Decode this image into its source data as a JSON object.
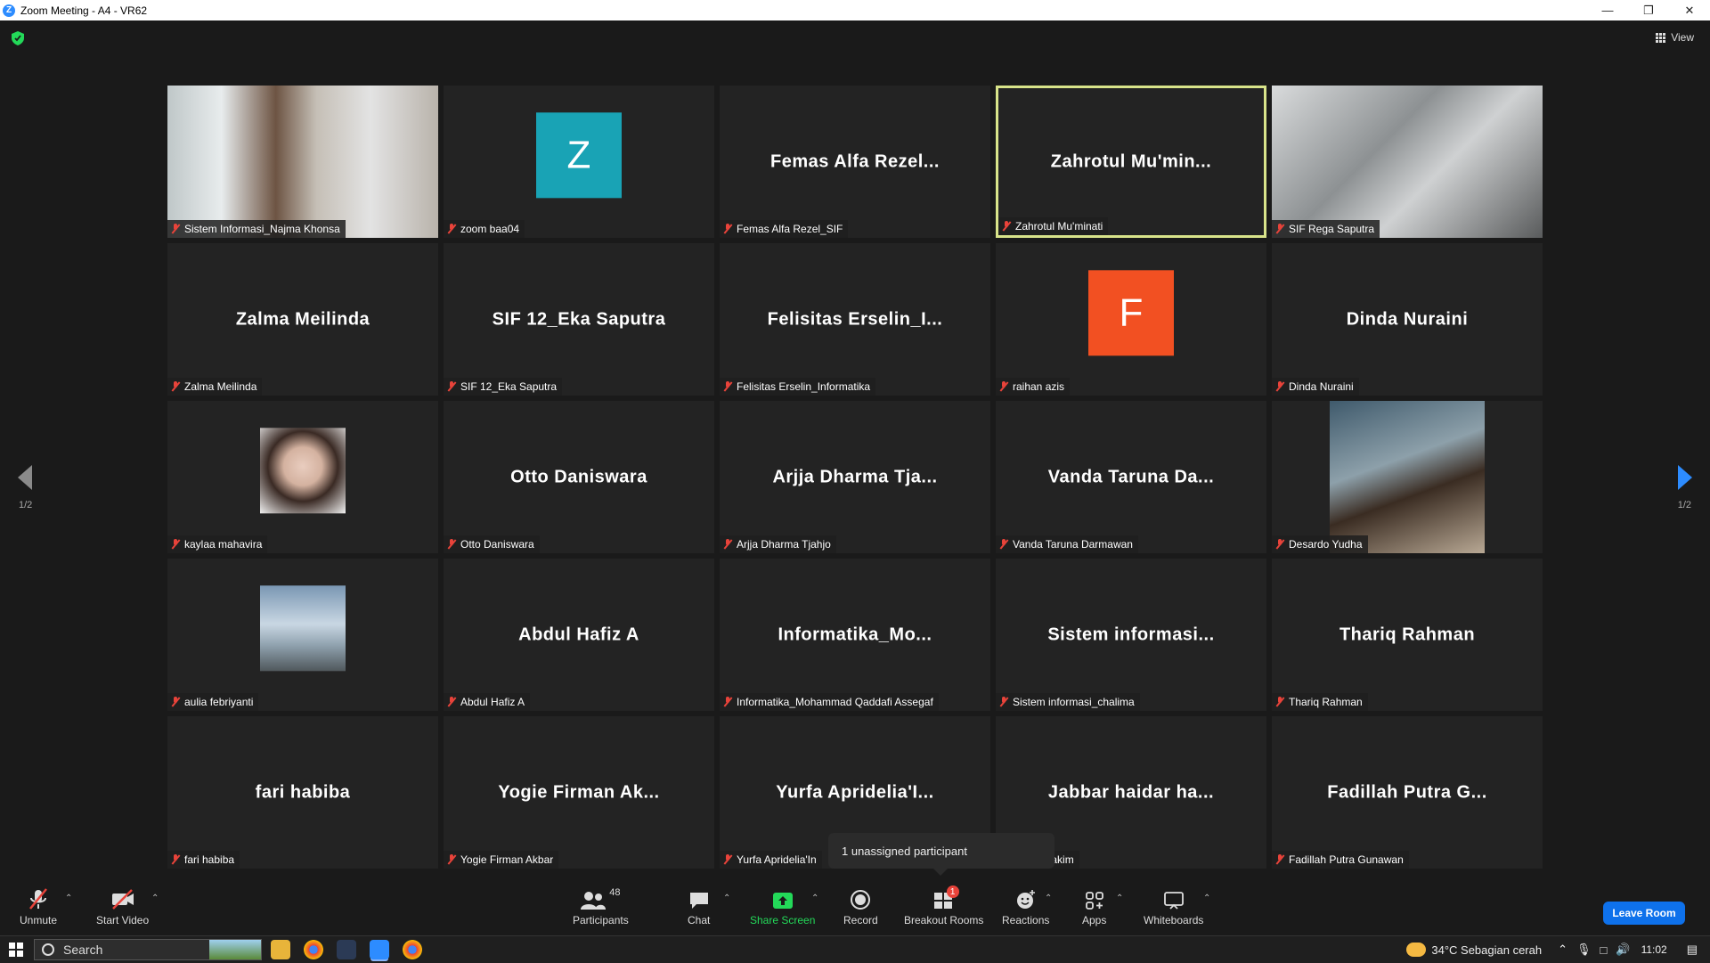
{
  "window": {
    "title": "Zoom Meeting - A4 - VR62"
  },
  "top": {
    "view_label": "View"
  },
  "pager": {
    "left": "1/2",
    "right": "1/2"
  },
  "tiles": [
    {
      "big": "",
      "label": "Sistem Informasi_Najma Khonsa",
      "kind": "photo"
    },
    {
      "big": "",
      "label": "zoom baa04",
      "kind": "letter",
      "letter": "Z",
      "color": "#19a3b5"
    },
    {
      "big": "Femas Alfa Rezel...",
      "label": "Femas Alfa Rezel_SIF",
      "kind": "name"
    },
    {
      "big": "Zahrotul Mu'min...",
      "label": "Zahrotul Mu'minati",
      "kind": "name",
      "active": true
    },
    {
      "big": "",
      "label": "SIF Rega Saputra",
      "kind": "photo"
    },
    {
      "big": "Zalma Meilinda",
      "label": "Zalma Meilinda",
      "kind": "name"
    },
    {
      "big": "SIF 12_Eka Saputra",
      "label": "SIF 12_Eka Saputra",
      "kind": "name"
    },
    {
      "big": "Felisitas Erselin_I...",
      "label": "Felisitas Erselin_Informatika",
      "kind": "name"
    },
    {
      "big": "",
      "label": "raihan azis",
      "kind": "letter",
      "letter": "F",
      "color": "#f25022"
    },
    {
      "big": "Dinda Nuraini",
      "label": "Dinda Nuraini",
      "kind": "name"
    },
    {
      "big": "",
      "label": "kaylaa mahavira",
      "kind": "smallphoto"
    },
    {
      "big": "Otto Daniswara",
      "label": "Otto Daniswara",
      "kind": "name"
    },
    {
      "big": "Arjja Dharma Tja...",
      "label": "Arjja Dharma Tjahjo",
      "kind": "name"
    },
    {
      "big": "Vanda Taruna Da...",
      "label": "Vanda Taruna Darmawan",
      "kind": "name"
    },
    {
      "big": "",
      "label": "Desardo Yudha",
      "kind": "photo"
    },
    {
      "big": "",
      "label": "aulia febriyanti",
      "kind": "smallphoto"
    },
    {
      "big": "Abdul Hafiz A",
      "label": "Abdul Hafiz A",
      "kind": "name"
    },
    {
      "big": "Informatika_Mo...",
      "label": "Informatika_Mohammad Qaddafi Assegaf",
      "kind": "name"
    },
    {
      "big": "Sistem informasi...",
      "label": "Sistem informasi_chalima",
      "kind": "name"
    },
    {
      "big": "Thariq Rahman",
      "label": "Thariq Rahman",
      "kind": "name"
    },
    {
      "big": "fari habiba",
      "label": "fari habiba",
      "kind": "name"
    },
    {
      "big": "Yogie Firman Ak...",
      "label": "Yogie Firman Akbar",
      "kind": "name"
    },
    {
      "big": "Yurfa Apridelia'I...",
      "label": "Yurfa Apridelia'In",
      "kind": "name"
    },
    {
      "big": "Jabbar haidar ha...",
      "label": "haidar hakim",
      "kind": "name"
    },
    {
      "big": "Fadillah Putra G...",
      "label": "Fadillah Putra Gunawan",
      "kind": "name"
    }
  ],
  "tooltip": {
    "text": "1 unassigned participant"
  },
  "toolbar": {
    "unmute": "Unmute",
    "start_video": "Start Video",
    "participants": "Participants",
    "participants_count": "48",
    "chat": "Chat",
    "share_screen": "Share Screen",
    "record": "Record",
    "breakout_rooms": "Breakout Rooms",
    "breakout_badge": "1",
    "reactions": "Reactions",
    "apps": "Apps",
    "whiteboards": "Whiteboards",
    "leave_room": "Leave Room"
  },
  "taskbar": {
    "search_placeholder": "Search",
    "weather": "34°C  Sebagian cerah",
    "time": "11:02"
  },
  "colors": {
    "accent": "#0e71eb",
    "active_border": "#d8e38a",
    "share_green": "#23d959",
    "muted_red": "#e8433a"
  }
}
